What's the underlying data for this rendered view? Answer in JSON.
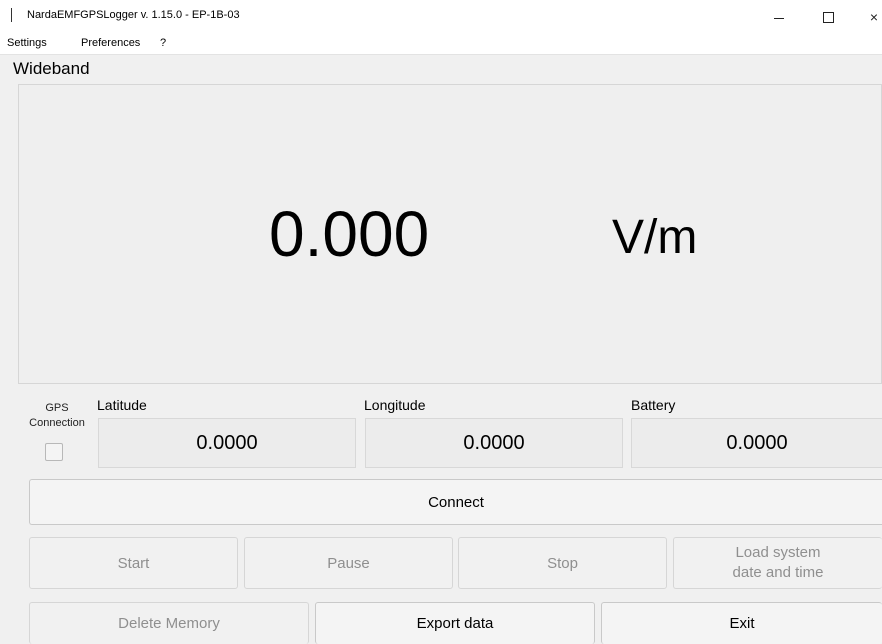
{
  "window": {
    "title": "NardaEMFGPSLogger v. 1.15.0 - EP-1B-03",
    "controls": {
      "minimize_icon": "minimize-icon",
      "maximize_icon": "maximize-icon",
      "close_glyph": "×"
    }
  },
  "menu": {
    "settings": "Settings",
    "preferences": "Preferences",
    "help": "?"
  },
  "wideband": {
    "label": "Wideband",
    "value": "0.000",
    "unit": "V/m"
  },
  "gps": {
    "label_line1": "GPS",
    "label_line2": "Connection",
    "checked": false
  },
  "readouts": {
    "latitude_label": "Latitude",
    "latitude_value": "0.0000",
    "longitude_label": "Longitude",
    "longitude_value": "0.0000",
    "battery_label": "Battery",
    "battery_value": "0.0000"
  },
  "buttons": {
    "connect": "Connect",
    "start": "Start",
    "pause": "Pause",
    "stop": "Stop",
    "load_line1": "Load system",
    "load_line2": "date and time",
    "delete_memory": "Delete Memory",
    "export_data": "Export data",
    "exit": "Exit"
  },
  "colors": {
    "background": "#f0f0f0",
    "disabled_text": "#8f8f8f"
  }
}
